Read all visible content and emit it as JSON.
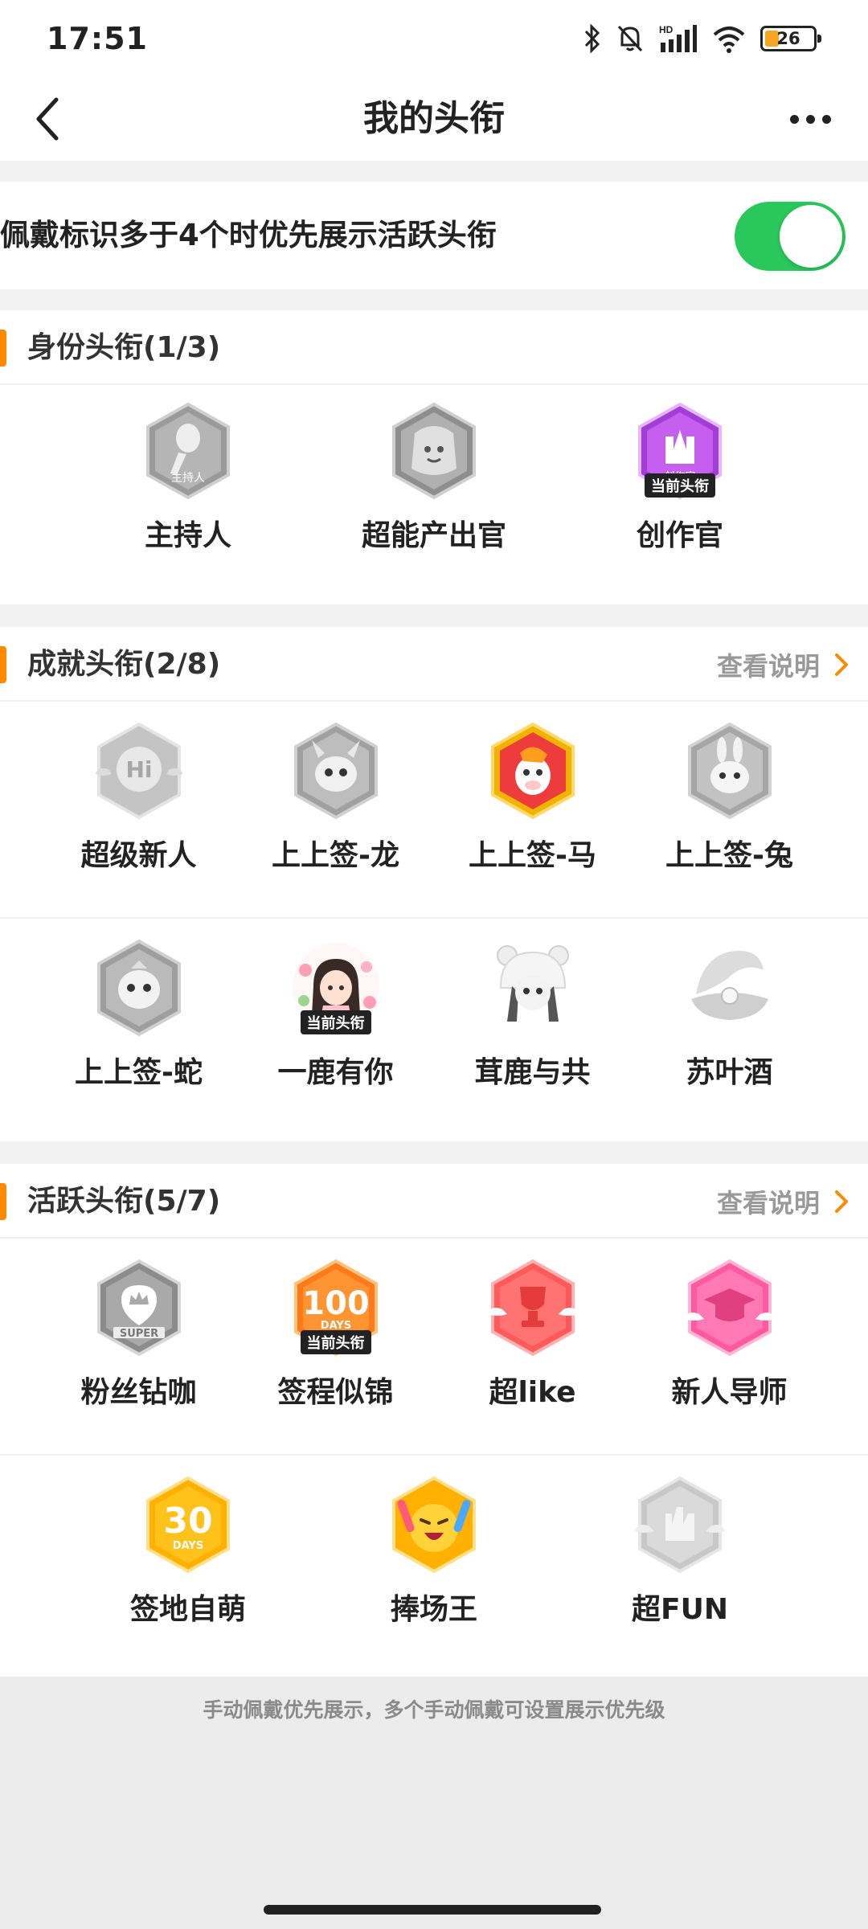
{
  "status_bar": {
    "time": "17:51",
    "battery_level": "26",
    "network_label": "HD"
  },
  "nav": {
    "title": "我的头衔"
  },
  "toggle": {
    "label": "佩戴标识多于4个时优先展示活跃头衔",
    "on": true
  },
  "sections": {
    "identity": {
      "title": "身份头衔(1/3)",
      "items": [
        {
          "name": "主持人",
          "icon": "host-microphone-badge-icon",
          "current": false
        },
        {
          "name": "超能产出官",
          "icon": "super-producer-badge-icon",
          "current": false
        },
        {
          "name": "创作官",
          "icon": "creator-badge-icon",
          "current": true,
          "icon_text": "创作官"
        }
      ]
    },
    "achievement": {
      "title": "成就头衔(2/8)",
      "link": "查看说明",
      "items": [
        {
          "name": "超级新人",
          "icon": "hi-badge-icon",
          "current": false,
          "icon_text": "Hi"
        },
        {
          "name": "上上签-龙",
          "icon": "dragon-badge-icon",
          "current": false
        },
        {
          "name": "上上签-马",
          "icon": "horse-badge-icon",
          "current": false
        },
        {
          "name": "上上签-兔",
          "icon": "rabbit-badge-icon",
          "current": false
        },
        {
          "name": "上上签-蛇",
          "icon": "snake-badge-icon",
          "current": false
        },
        {
          "name": "一鹿有你",
          "icon": "girl-avatar-badge-icon",
          "current": true
        },
        {
          "name": "茸鹿与共",
          "icon": "girl-bear-hat-badge-icon",
          "current": false
        },
        {
          "name": "苏叶酒",
          "icon": "shell-pearl-badge-icon",
          "current": false
        }
      ]
    },
    "active": {
      "title": "活跃头衔(5/7)",
      "link": "查看说明",
      "items": [
        {
          "name": "粉丝钻咖",
          "icon": "super-fan-crown-badge-icon",
          "current": false,
          "icon_text": "SUPER"
        },
        {
          "name": "签程似锦",
          "icon": "100-days-badge-icon",
          "current": true,
          "icon_text": "100",
          "icon_sub": "DAYS"
        },
        {
          "name": "超like",
          "icon": "trophy-badge-icon",
          "current": false
        },
        {
          "name": "新人导师",
          "icon": "mentor-cap-badge-icon",
          "current": false
        },
        {
          "name": "签地自萌",
          "icon": "30-days-badge-icon",
          "current": false,
          "icon_text": "30",
          "icon_sub": "DAYS"
        },
        {
          "name": "捧场王",
          "icon": "cheer-face-badge-icon",
          "current": false
        },
        {
          "name": "超FUN",
          "icon": "fun-hand-badge-icon",
          "current": false
        }
      ]
    }
  },
  "current_tag": "当前头衔",
  "footer_note": "手动佩戴优先展示，多个手动佩戴可设置展示优先级",
  "colors": {
    "accent": "#ff8a00",
    "toggle_on": "#2ac85c"
  }
}
